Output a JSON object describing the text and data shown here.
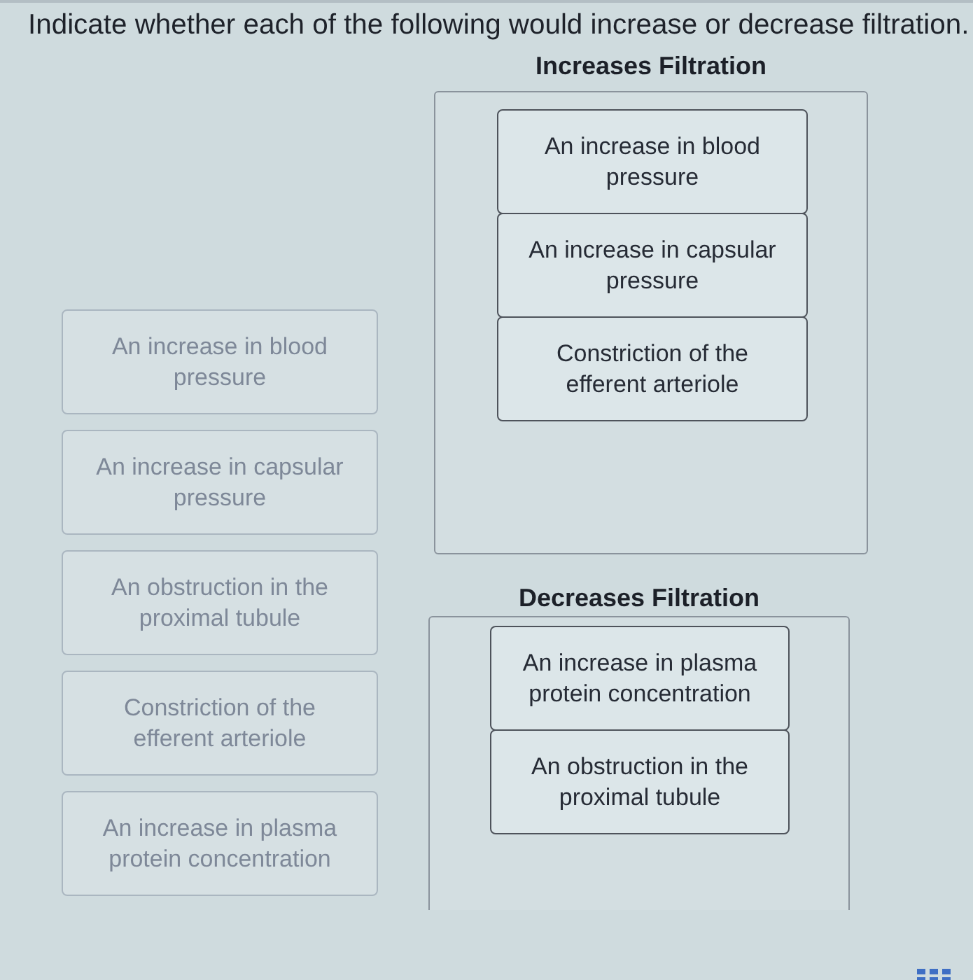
{
  "instruction": "Indicate whether each of the following would increase or decrease filtration.",
  "source_items": [
    {
      "text": "An increase in blood pressure",
      "placed": true
    },
    {
      "text": "An increase in capsular pressure",
      "placed": true
    },
    {
      "text": "An obstruction in the proximal tubule",
      "placed": true
    },
    {
      "text": "Constriction of the efferent arteriole",
      "placed": true
    },
    {
      "text": "An increase in plasma protein concentration",
      "placed": true
    }
  ],
  "bins": [
    {
      "title": "Increases Filtration",
      "items": [
        {
          "text": "An increase in blood pressure"
        },
        {
          "text": "An increase in capsular pressure"
        },
        {
          "text": "Constriction of the efferent arteriole"
        }
      ]
    },
    {
      "title": "Decreases Filtration",
      "items": [
        {
          "text": "An increase in plasma protein concentration"
        },
        {
          "text": "An obstruction in the proximal tubule"
        }
      ]
    }
  ]
}
